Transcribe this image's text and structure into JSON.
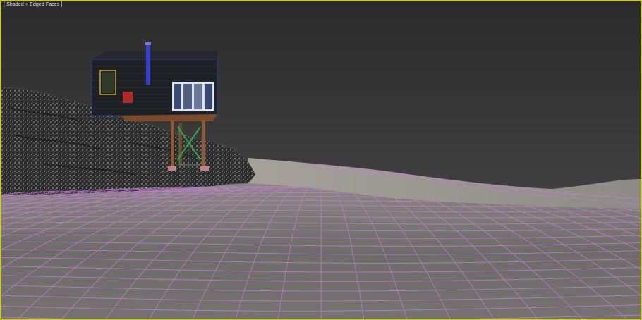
{
  "viewport": {
    "label": "[ Shaded + Edged Faces ]",
    "border_color": "#c9c93a",
    "wire_color": "#c27dd4"
  }
}
